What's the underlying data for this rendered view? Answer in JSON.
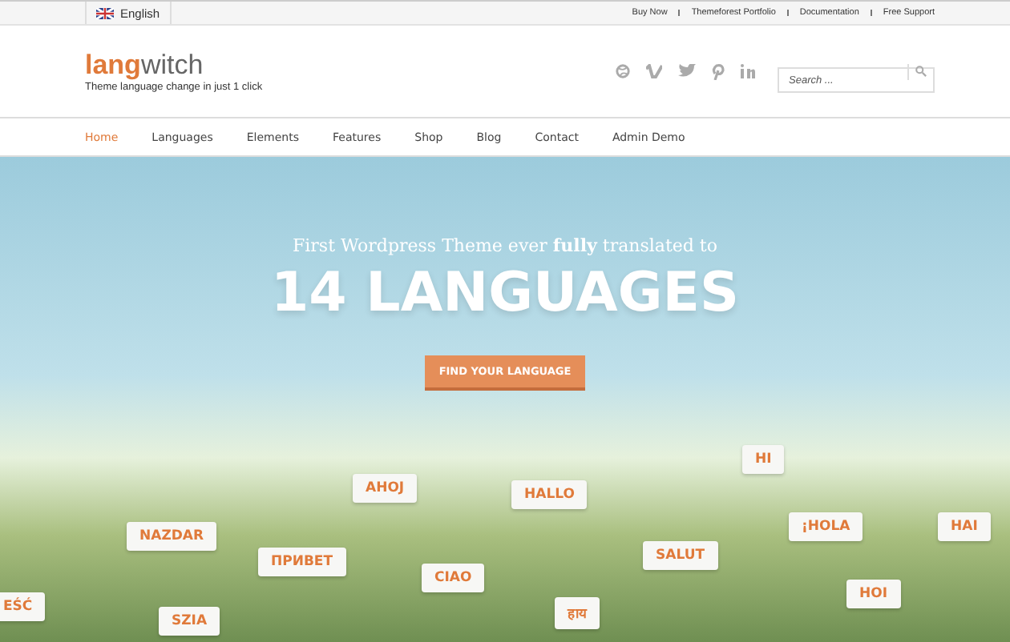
{
  "top_bar": {
    "language": "English",
    "links": [
      "Buy Now",
      "Themeforest Portfolio",
      "Documentation",
      "Free Support"
    ]
  },
  "header": {
    "logo_bold": "lang",
    "logo_rest": "witch",
    "tagline": "Theme language change in just 1 click",
    "search": {
      "placeholder": "Search ..."
    }
  },
  "nav": [
    {
      "label": "Home",
      "selected": true
    },
    {
      "label": "Languages",
      "selected": false
    },
    {
      "label": "Elements",
      "selected": false
    },
    {
      "label": "Features",
      "selected": false
    },
    {
      "label": "Shop",
      "selected": false
    },
    {
      "label": "Blog",
      "selected": false
    },
    {
      "label": "Contact",
      "selected": false
    },
    {
      "label": "Admin Demo",
      "selected": false
    }
  ],
  "hero": {
    "subtitle_start": "First Wordpress Theme ever ",
    "subtitle_emphasis": "fully",
    "subtitle_end": " translated to",
    "title": "14 LANGUAGES",
    "button": "FIND YOUR LANGUAGE",
    "greetings": [
      "AHOJ",
      "HALLO",
      "HI",
      "NAZDAR",
      "¡HOLA",
      "HAI",
      "ПРИВЕТ",
      "SALUT",
      "CIAO",
      "EŚĆ",
      "HOI",
      "हाय",
      "SZIA"
    ]
  }
}
